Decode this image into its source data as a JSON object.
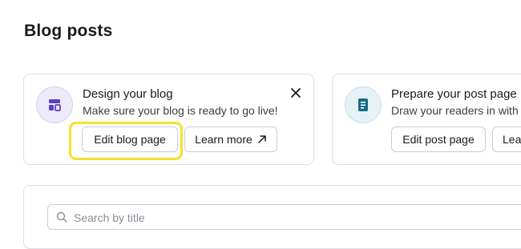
{
  "page": {
    "title": "Blog posts"
  },
  "cards": [
    {
      "title": "Design your blog",
      "subtitle": "Make sure your blog is ready to go live!",
      "icon": "layout-icon",
      "primary_button": "Edit blog page",
      "secondary_button": "Learn more",
      "secondary_icon": "arrow-up-right-icon",
      "closable": true
    },
    {
      "title": "Prepare your post page",
      "subtitle": "Draw your readers in with",
      "icon": "document-icon",
      "primary_button": "Edit post page",
      "secondary_button": "Lea"
    }
  ],
  "search": {
    "placeholder": "Search by title",
    "value": ""
  },
  "colors": {
    "highlight": "#f6e12b",
    "card1_icon": "#5b3fc4",
    "card2_icon": "#1a6a86",
    "border": "#dcdfe3"
  }
}
